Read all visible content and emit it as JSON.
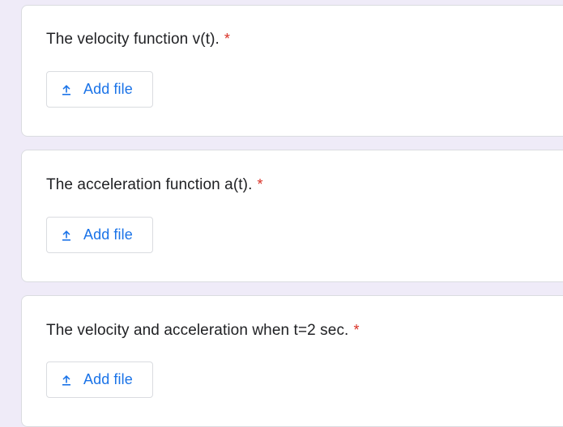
{
  "questions": [
    {
      "text": "The velocity function v(t).",
      "required_mark": "*",
      "upload_button_label": "Add file"
    },
    {
      "text": "The acceleration function a(t).",
      "required_mark": "*",
      "upload_button_label": "Add file"
    },
    {
      "text": "The velocity and acceleration when t=2 sec.",
      "required_mark": "*",
      "upload_button_label": "Add file"
    }
  ],
  "colors": {
    "page_background": "#efebf8",
    "card_background": "#ffffff",
    "required": "#d93025",
    "accent": "#1a73e8",
    "text": "#202124",
    "border": "#dadce0"
  },
  "icons": {
    "upload": "upload-icon"
  }
}
